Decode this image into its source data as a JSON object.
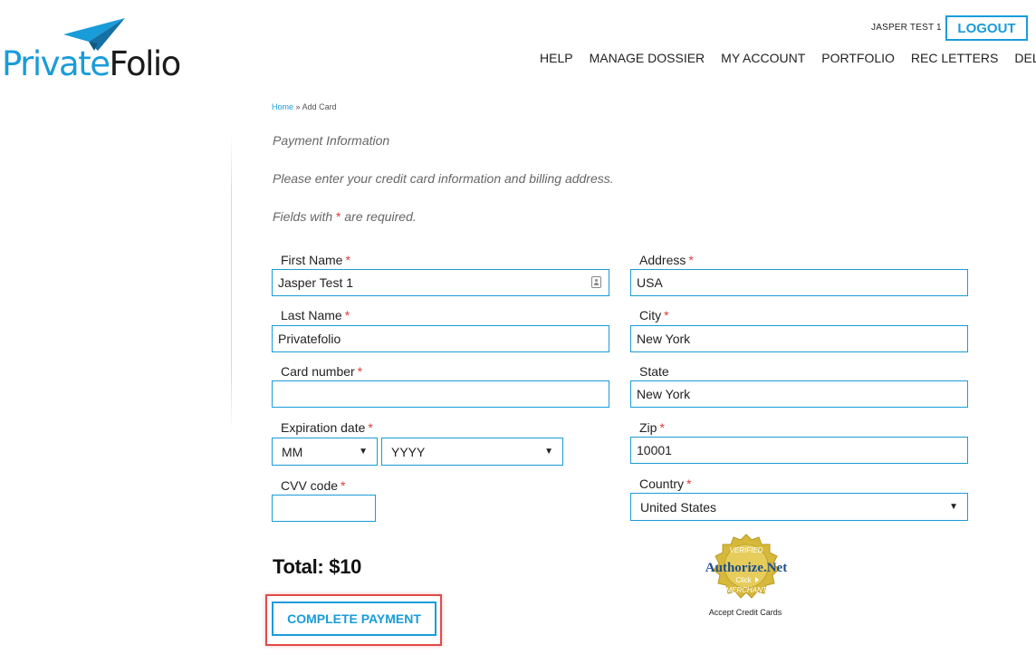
{
  "brand": {
    "logo_part1": "Private",
    "logo_part2": "Folio"
  },
  "header": {
    "user_name": "JASPER TEST 1",
    "logout_label": "LOGOUT",
    "nav": [
      "HELP",
      "MANAGE DOSSIER",
      "MY ACCOUNT",
      "PORTFOLIO",
      "REC LETTERS",
      "DELIVERY"
    ]
  },
  "breadcrumb": {
    "home": "Home",
    "separator": "»",
    "current": "Add Card"
  },
  "intro": {
    "heading": "Payment Information",
    "instructions": "Please enter your credit card information and billing address.",
    "required_prefix": "Fields with",
    "required_marker": "*",
    "required_suffix": "are required."
  },
  "form": {
    "first_name": {
      "label": "First Name",
      "value": "Jasper Test 1"
    },
    "last_name": {
      "label": "Last Name",
      "value": "Privatefolio"
    },
    "card_number": {
      "label": "Card number",
      "value": ""
    },
    "expiration": {
      "label": "Expiration date",
      "month": "MM",
      "year": "YYYY"
    },
    "cvv": {
      "label": "CVV code",
      "value": ""
    },
    "address": {
      "label": "Address",
      "value": "USA"
    },
    "city": {
      "label": "City",
      "value": "New York"
    },
    "state": {
      "label": "State",
      "value": "New York"
    },
    "zip": {
      "label": "Zip",
      "value": "10001"
    },
    "country": {
      "label": "Country",
      "value": "United States"
    },
    "required_marker": "*"
  },
  "total": {
    "label": "Total: $10"
  },
  "pay_button": {
    "label": "COMPLETE PAYMENT"
  },
  "seal": {
    "top_text": "VERIFIED",
    "brand": "Authorize.Net",
    "click": "Click",
    "bottom_text": "MERCHANT",
    "caption": "Accept Credit Cards"
  },
  "colors": {
    "accent": "#1a9cd8",
    "required": "#e03b3b",
    "highlight": "#e34a4a",
    "seal_gold": "#d6b83a"
  }
}
